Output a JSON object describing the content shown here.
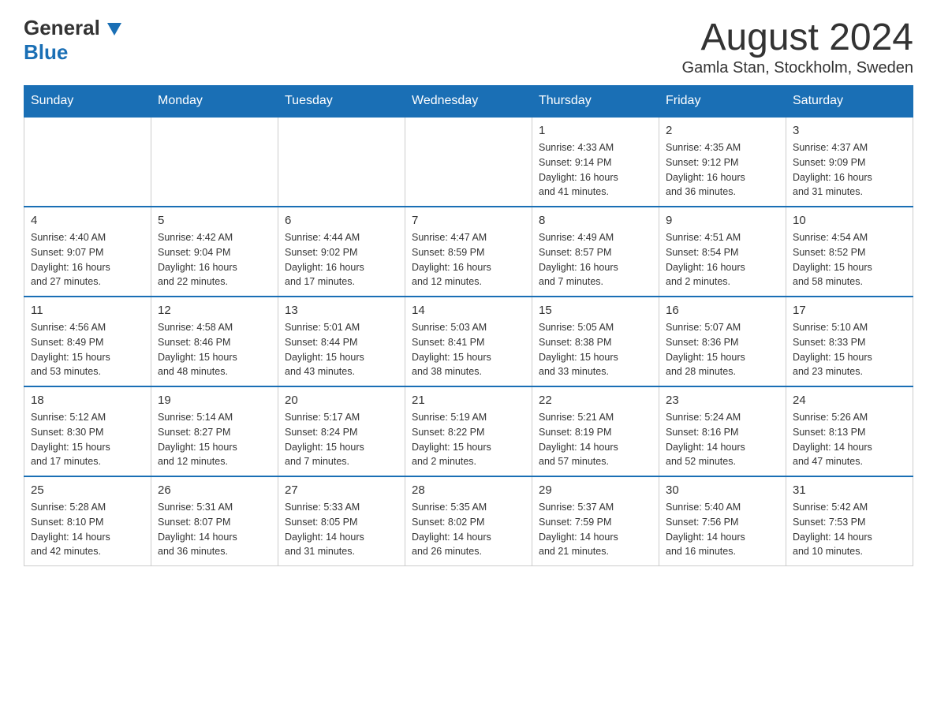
{
  "header": {
    "logo_general": "General",
    "logo_blue": "Blue",
    "month_title": "August 2024",
    "location": "Gamla Stan, Stockholm, Sweden"
  },
  "days_of_week": [
    "Sunday",
    "Monday",
    "Tuesday",
    "Wednesday",
    "Thursday",
    "Friday",
    "Saturday"
  ],
  "weeks": [
    {
      "days": [
        {
          "number": "",
          "info": ""
        },
        {
          "number": "",
          "info": ""
        },
        {
          "number": "",
          "info": ""
        },
        {
          "number": "",
          "info": ""
        },
        {
          "number": "1",
          "info": "Sunrise: 4:33 AM\nSunset: 9:14 PM\nDaylight: 16 hours\nand 41 minutes."
        },
        {
          "number": "2",
          "info": "Sunrise: 4:35 AM\nSunset: 9:12 PM\nDaylight: 16 hours\nand 36 minutes."
        },
        {
          "number": "3",
          "info": "Sunrise: 4:37 AM\nSunset: 9:09 PM\nDaylight: 16 hours\nand 31 minutes."
        }
      ]
    },
    {
      "days": [
        {
          "number": "4",
          "info": "Sunrise: 4:40 AM\nSunset: 9:07 PM\nDaylight: 16 hours\nand 27 minutes."
        },
        {
          "number": "5",
          "info": "Sunrise: 4:42 AM\nSunset: 9:04 PM\nDaylight: 16 hours\nand 22 minutes."
        },
        {
          "number": "6",
          "info": "Sunrise: 4:44 AM\nSunset: 9:02 PM\nDaylight: 16 hours\nand 17 minutes."
        },
        {
          "number": "7",
          "info": "Sunrise: 4:47 AM\nSunset: 8:59 PM\nDaylight: 16 hours\nand 12 minutes."
        },
        {
          "number": "8",
          "info": "Sunrise: 4:49 AM\nSunset: 8:57 PM\nDaylight: 16 hours\nand 7 minutes."
        },
        {
          "number": "9",
          "info": "Sunrise: 4:51 AM\nSunset: 8:54 PM\nDaylight: 16 hours\nand 2 minutes."
        },
        {
          "number": "10",
          "info": "Sunrise: 4:54 AM\nSunset: 8:52 PM\nDaylight: 15 hours\nand 58 minutes."
        }
      ]
    },
    {
      "days": [
        {
          "number": "11",
          "info": "Sunrise: 4:56 AM\nSunset: 8:49 PM\nDaylight: 15 hours\nand 53 minutes."
        },
        {
          "number": "12",
          "info": "Sunrise: 4:58 AM\nSunset: 8:46 PM\nDaylight: 15 hours\nand 48 minutes."
        },
        {
          "number": "13",
          "info": "Sunrise: 5:01 AM\nSunset: 8:44 PM\nDaylight: 15 hours\nand 43 minutes."
        },
        {
          "number": "14",
          "info": "Sunrise: 5:03 AM\nSunset: 8:41 PM\nDaylight: 15 hours\nand 38 minutes."
        },
        {
          "number": "15",
          "info": "Sunrise: 5:05 AM\nSunset: 8:38 PM\nDaylight: 15 hours\nand 33 minutes."
        },
        {
          "number": "16",
          "info": "Sunrise: 5:07 AM\nSunset: 8:36 PM\nDaylight: 15 hours\nand 28 minutes."
        },
        {
          "number": "17",
          "info": "Sunrise: 5:10 AM\nSunset: 8:33 PM\nDaylight: 15 hours\nand 23 minutes."
        }
      ]
    },
    {
      "days": [
        {
          "number": "18",
          "info": "Sunrise: 5:12 AM\nSunset: 8:30 PM\nDaylight: 15 hours\nand 17 minutes."
        },
        {
          "number": "19",
          "info": "Sunrise: 5:14 AM\nSunset: 8:27 PM\nDaylight: 15 hours\nand 12 minutes."
        },
        {
          "number": "20",
          "info": "Sunrise: 5:17 AM\nSunset: 8:24 PM\nDaylight: 15 hours\nand 7 minutes."
        },
        {
          "number": "21",
          "info": "Sunrise: 5:19 AM\nSunset: 8:22 PM\nDaylight: 15 hours\nand 2 minutes."
        },
        {
          "number": "22",
          "info": "Sunrise: 5:21 AM\nSunset: 8:19 PM\nDaylight: 14 hours\nand 57 minutes."
        },
        {
          "number": "23",
          "info": "Sunrise: 5:24 AM\nSunset: 8:16 PM\nDaylight: 14 hours\nand 52 minutes."
        },
        {
          "number": "24",
          "info": "Sunrise: 5:26 AM\nSunset: 8:13 PM\nDaylight: 14 hours\nand 47 minutes."
        }
      ]
    },
    {
      "days": [
        {
          "number": "25",
          "info": "Sunrise: 5:28 AM\nSunset: 8:10 PM\nDaylight: 14 hours\nand 42 minutes."
        },
        {
          "number": "26",
          "info": "Sunrise: 5:31 AM\nSunset: 8:07 PM\nDaylight: 14 hours\nand 36 minutes."
        },
        {
          "number": "27",
          "info": "Sunrise: 5:33 AM\nSunset: 8:05 PM\nDaylight: 14 hours\nand 31 minutes."
        },
        {
          "number": "28",
          "info": "Sunrise: 5:35 AM\nSunset: 8:02 PM\nDaylight: 14 hours\nand 26 minutes."
        },
        {
          "number": "29",
          "info": "Sunrise: 5:37 AM\nSunset: 7:59 PM\nDaylight: 14 hours\nand 21 minutes."
        },
        {
          "number": "30",
          "info": "Sunrise: 5:40 AM\nSunset: 7:56 PM\nDaylight: 14 hours\nand 16 minutes."
        },
        {
          "number": "31",
          "info": "Sunrise: 5:42 AM\nSunset: 7:53 PM\nDaylight: 14 hours\nand 10 minutes."
        }
      ]
    }
  ]
}
